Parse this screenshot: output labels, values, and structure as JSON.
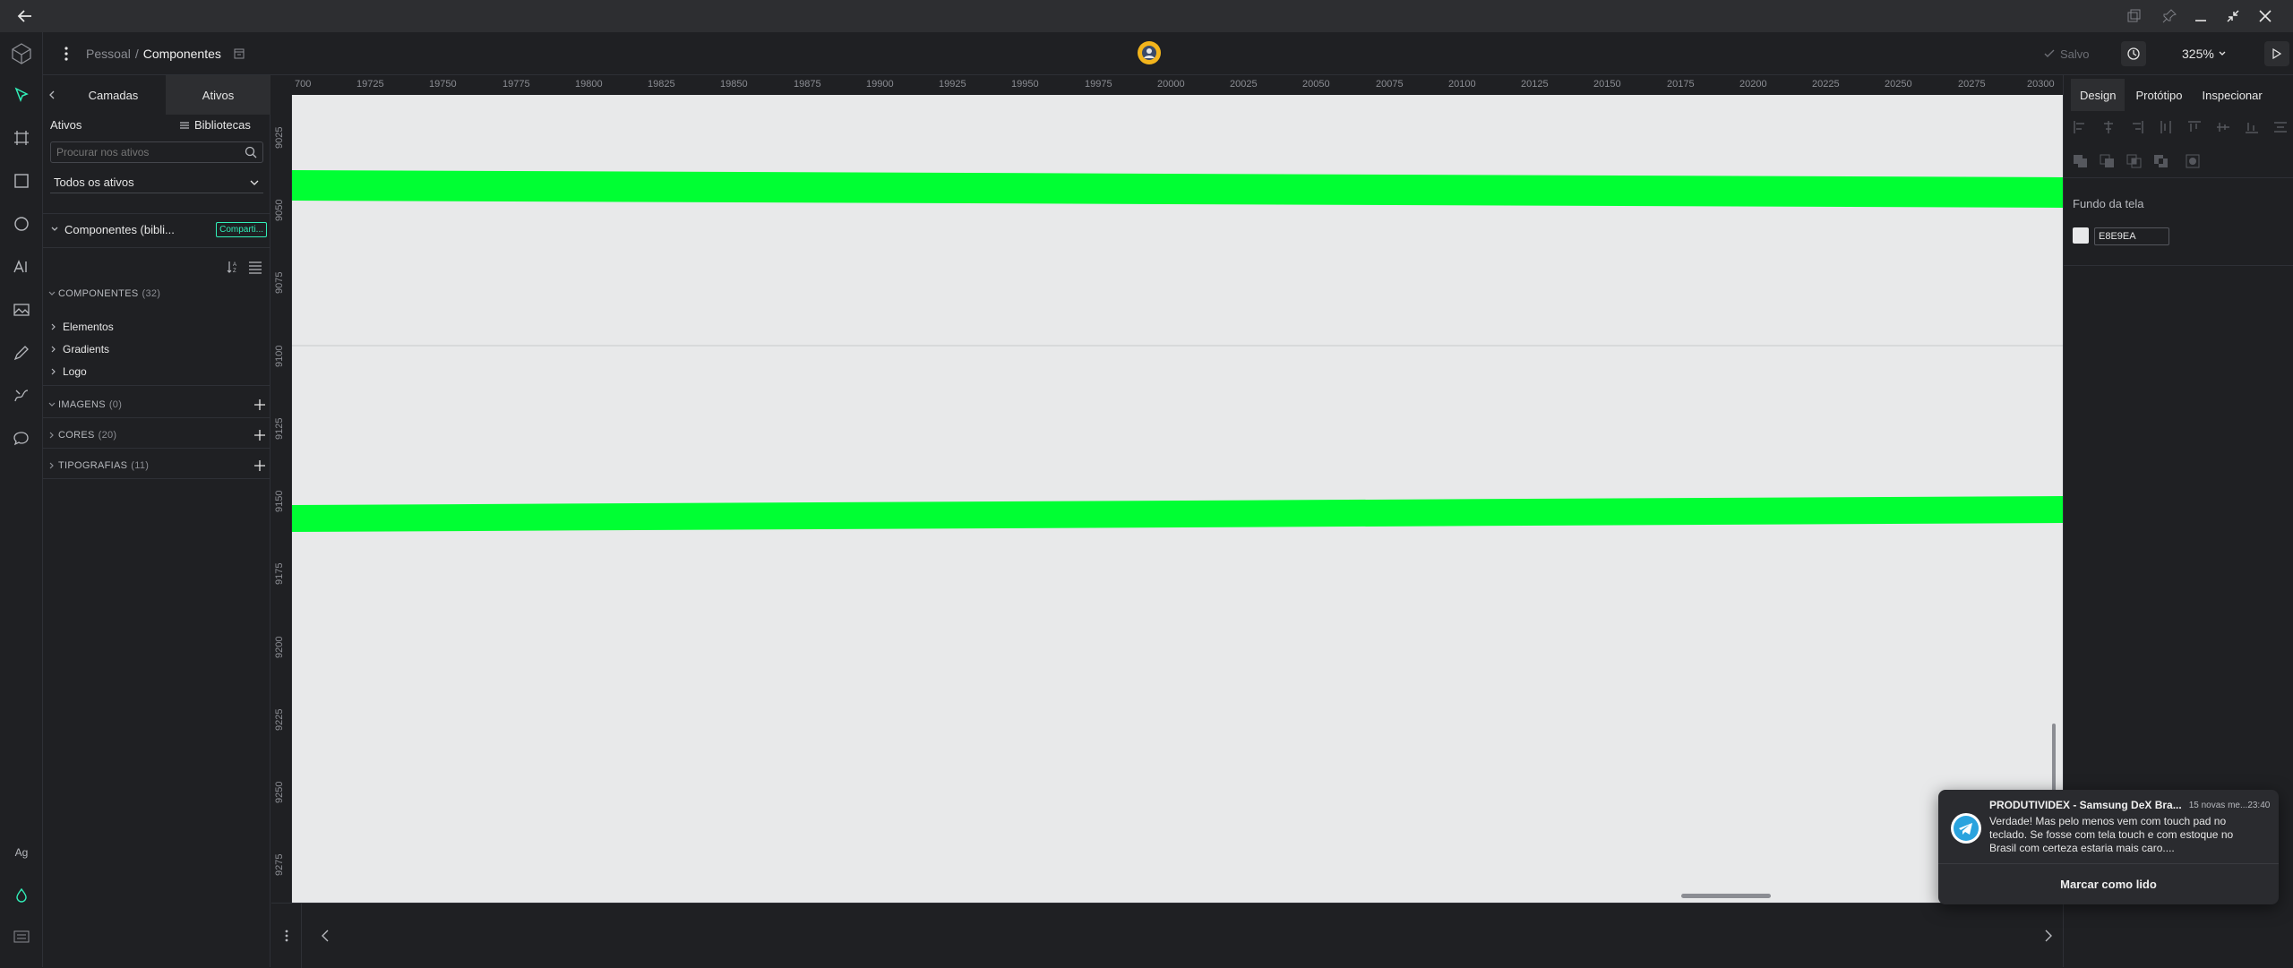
{
  "titlebar": {
    "back_icon": "arrow-left-icon",
    "controls": [
      "window-layout-icon",
      "pin-icon",
      "minimize-icon",
      "restore-icon",
      "close-icon"
    ]
  },
  "appbar": {
    "breadcrumb_parent": "Pessoal",
    "breadcrumb_separator": "/",
    "breadcrumb_current": "Componentes",
    "saved_label": "Salvo",
    "zoom": "325%"
  },
  "left_tools": [
    "move-icon",
    "board-icon",
    "rectangle-icon",
    "ellipse-icon",
    "text-icon",
    "image-icon",
    "pen-icon",
    "curve-icon",
    "comment-icon"
  ],
  "left_bottom": {
    "fonts_label": "Ag"
  },
  "sidebar": {
    "tabs": [
      "Camadas",
      "Ativos"
    ],
    "assets_title": "Ativos",
    "libraries_label": "Bibliotecas",
    "search_placeholder": "Procurar nos ativos",
    "filter_value": "Todos os ativos",
    "library_name": "Componentes (bibli...",
    "share_button": "Comparti...",
    "components_label": "COMPONENTES",
    "components_count": "(32)",
    "groups": [
      "Elementos",
      "Gradients",
      "Logo"
    ],
    "images_label": "IMAGENS",
    "images_count": "(0)",
    "colors_label": "CORES",
    "colors_count": "(20)",
    "typography_label": "TIPOGRAFIAS",
    "typography_count": "(11)"
  },
  "rulers": {
    "top": [
      "700",
      "19725",
      "19750",
      "19775",
      "19800",
      "19825",
      "19850",
      "19875",
      "19900",
      "19925",
      "19950",
      "19975",
      "20000",
      "20025",
      "20050",
      "20075",
      "20100",
      "20125",
      "20150",
      "20175",
      "20200",
      "20225",
      "20250",
      "20275",
      "20300"
    ],
    "left": [
      "9025",
      "9050",
      "9075",
      "9100",
      "9125",
      "9150",
      "9175",
      "9200",
      "9225",
      "9250",
      "9275"
    ]
  },
  "canvas": {
    "background": "#E8E9EA",
    "stripe_color": "#00FF33"
  },
  "right_panel": {
    "tabs": [
      "Design",
      "Protótipo",
      "Inspecionar"
    ],
    "canvas_bg_label": "Fundo da tela",
    "canvas_bg_value": "E8E9EA"
  },
  "notification": {
    "app_icon": "telegram-icon",
    "title": "PRODUTIVIDEX - Samsung DeX Bra...",
    "meta": "15 novas me...",
    "time": "23:40",
    "message": "Verdade! Mas pelo menos vem com touch pad no teclado. Se fosse com tela touch e com estoque no Brasil com certeza estaria mais caro....",
    "action": "Marcar como lido"
  }
}
